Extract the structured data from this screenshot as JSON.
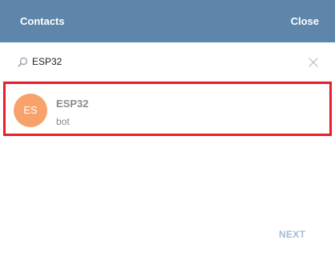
{
  "header": {
    "title": "Contacts",
    "close_label": "Close",
    "background_color": "#5e86ab"
  },
  "search": {
    "value": "ESP32",
    "icon": "search-icon",
    "clear_icon": "close-icon"
  },
  "results": [
    {
      "avatar_initials": "ES",
      "avatar_color": "#f7a26b",
      "name": "ESP32",
      "status": "bot",
      "highlight_color": "#e8202a"
    }
  ],
  "footer": {
    "next_label": "NEXT"
  }
}
